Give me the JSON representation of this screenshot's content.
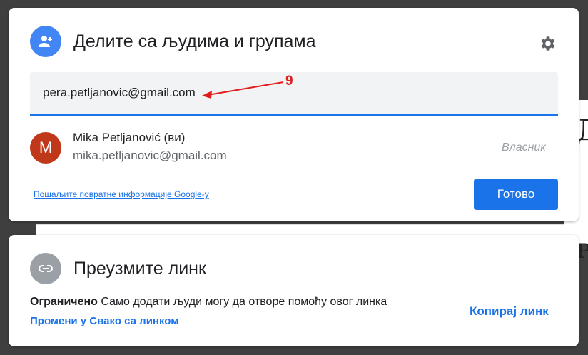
{
  "share": {
    "title": "Делите са људима и групама",
    "input_value": "pera.petljanovic@gmail.com",
    "annotation_number": "9",
    "user": {
      "avatar_letter": "M",
      "name": "Mika Petljanović (ви)",
      "email": "mika.petljanovic@gmail.com",
      "role": "Власник"
    },
    "feedback_link": "Пошаљите повратне информације Google-у",
    "done_label": "Готово"
  },
  "link": {
    "title": "Преузмите линк",
    "restricted_label": "Ограничено",
    "restricted_desc": "Само додати људи могу да отворе помоћу овог линка",
    "change_label": "Промени у Свако са линком",
    "copy_label": "Копирај линк"
  },
  "icons": {
    "share_header": "person-add-icon",
    "settings": "gear-icon",
    "link_header": "link-icon"
  },
  "colors": {
    "primary": "#1a73e8",
    "share_icon_bg": "#4285f4",
    "link_icon_bg": "#9aa0a6",
    "avatar_bg": "#c0381a",
    "annotation": "#e31c1c"
  }
}
